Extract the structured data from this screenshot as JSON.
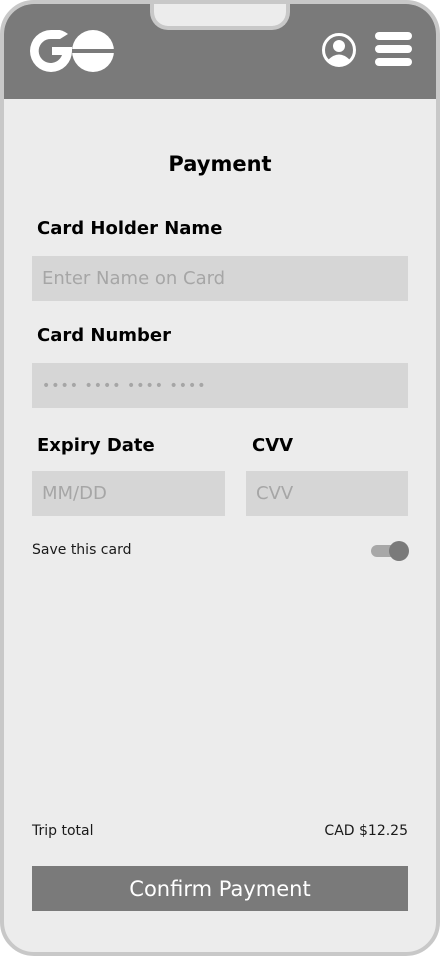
{
  "app": {
    "logo_icon": "go-logo",
    "profile_icon": "user-circle-icon",
    "menu_icon": "hamburger-menu-icon"
  },
  "page": {
    "title": "Payment"
  },
  "form": {
    "card_holder": {
      "label": "Card Holder Name",
      "placeholder": "Enter Name on Card",
      "value": ""
    },
    "card_number": {
      "label": "Card Number",
      "placeholder": "•••• •••• •••• ••••",
      "value": ""
    },
    "expiry": {
      "label": "Expiry Date",
      "placeholder": "MM/DD",
      "value": ""
    },
    "cvv": {
      "label": "CVV",
      "placeholder": "CVV",
      "value": ""
    },
    "save_card": {
      "label": "Save this card",
      "enabled": true
    }
  },
  "summary": {
    "total_label": "Trip total",
    "total_value": "CAD $12.25"
  },
  "actions": {
    "confirm_label": "Confirm Payment"
  },
  "colors": {
    "header": "#7a7a7a",
    "background": "#ececec",
    "field": "#d6d6d6",
    "button": "#7a7a7a",
    "placeholder_text": "#a6a6a6"
  }
}
